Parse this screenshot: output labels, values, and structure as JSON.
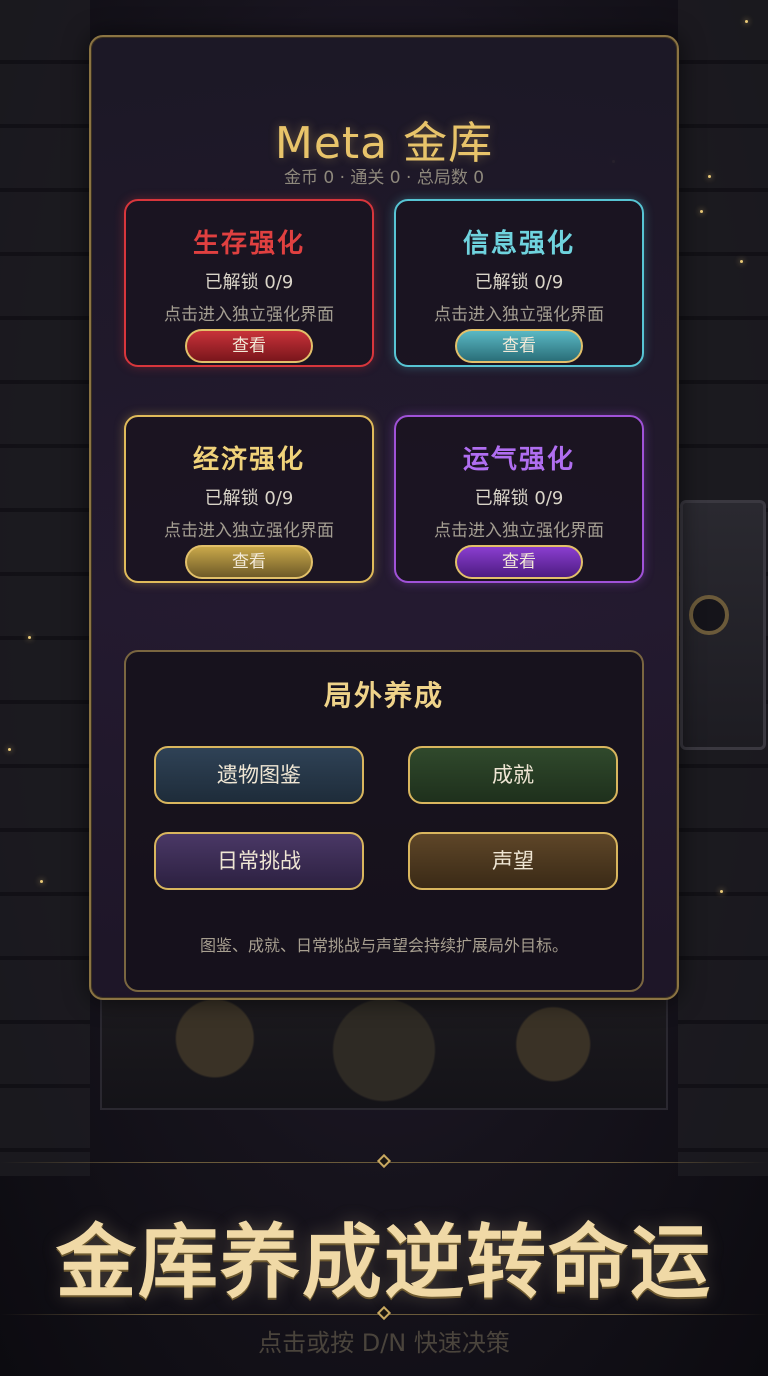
{
  "header": {
    "title": "Meta 金库",
    "stats": "金币 0 · 通关 0 · 总局数 0"
  },
  "cards": [
    {
      "id": "survival",
      "title": "生存强化",
      "unlocked": "已解锁 0/9",
      "desc": "点击进入独立强化界面",
      "button": "查看",
      "color": "#d8363c"
    },
    {
      "id": "info",
      "title": "信息强化",
      "unlocked": "已解锁 0/9",
      "desc": "点击进入独立强化界面",
      "button": "查看",
      "color": "#57c5d4"
    },
    {
      "id": "economy",
      "title": "经济强化",
      "unlocked": "已解锁 0/9",
      "desc": "点击进入独立强化界面",
      "button": "查看",
      "color": "#e0bb5a"
    },
    {
      "id": "luck",
      "title": "运气强化",
      "unlocked": "已解锁 0/9",
      "desc": "点击进入独立强化界面",
      "button": "查看",
      "color": "#a052d8"
    }
  ],
  "meta": {
    "title": "局外养成",
    "buttons": [
      "遗物图鉴",
      "成就",
      "日常挑战",
      "声望"
    ],
    "note": "图鉴、成就、日常挑战与声望会持续扩展局外目标。"
  },
  "footer": {
    "slogan": "金库养成逆转命运",
    "hint": "点击或按 D/N 快速决策"
  },
  "colors": {
    "accent_gold": "#e8c46a",
    "panel_border": "#8b7443"
  },
  "icons": [
    "keyhole-icon",
    "gear-icon"
  ]
}
